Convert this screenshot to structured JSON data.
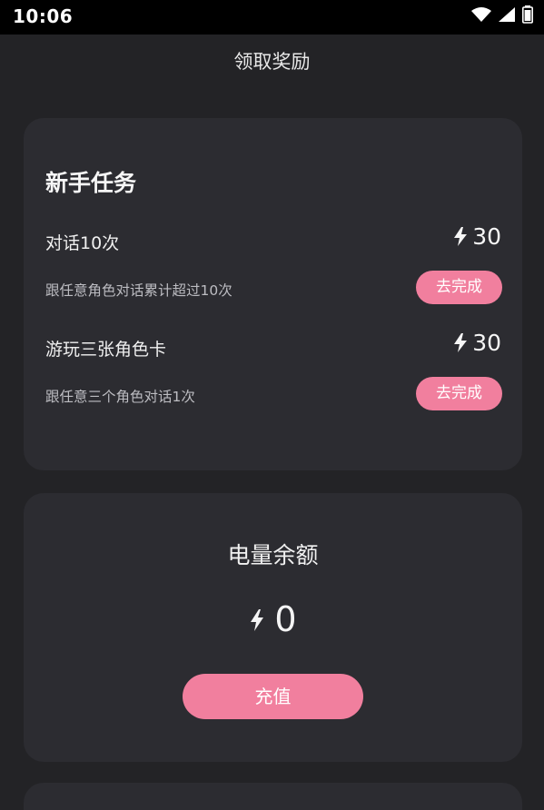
{
  "status_bar": {
    "time": "10:06",
    "icons": [
      "wifi-icon",
      "signal-icon",
      "battery-icon"
    ]
  },
  "header": {
    "title": "领取奖励"
  },
  "task_card": {
    "title": "新手任务",
    "tasks": [
      {
        "name": "对话10次",
        "description": "跟任意角色对话累计超过10次",
        "reward": "30",
        "button_label": "去完成"
      },
      {
        "name": "游玩三张角色卡",
        "description": "跟任意三个角色对话1次",
        "reward": "30",
        "button_label": "去完成"
      }
    ]
  },
  "balance_card": {
    "title": "电量余额",
    "amount": "0",
    "button_label": "充值"
  },
  "colors": {
    "background": "#232326",
    "card": "#2c2c31",
    "accent": "#f17f9e",
    "status_bar": "#000000"
  }
}
